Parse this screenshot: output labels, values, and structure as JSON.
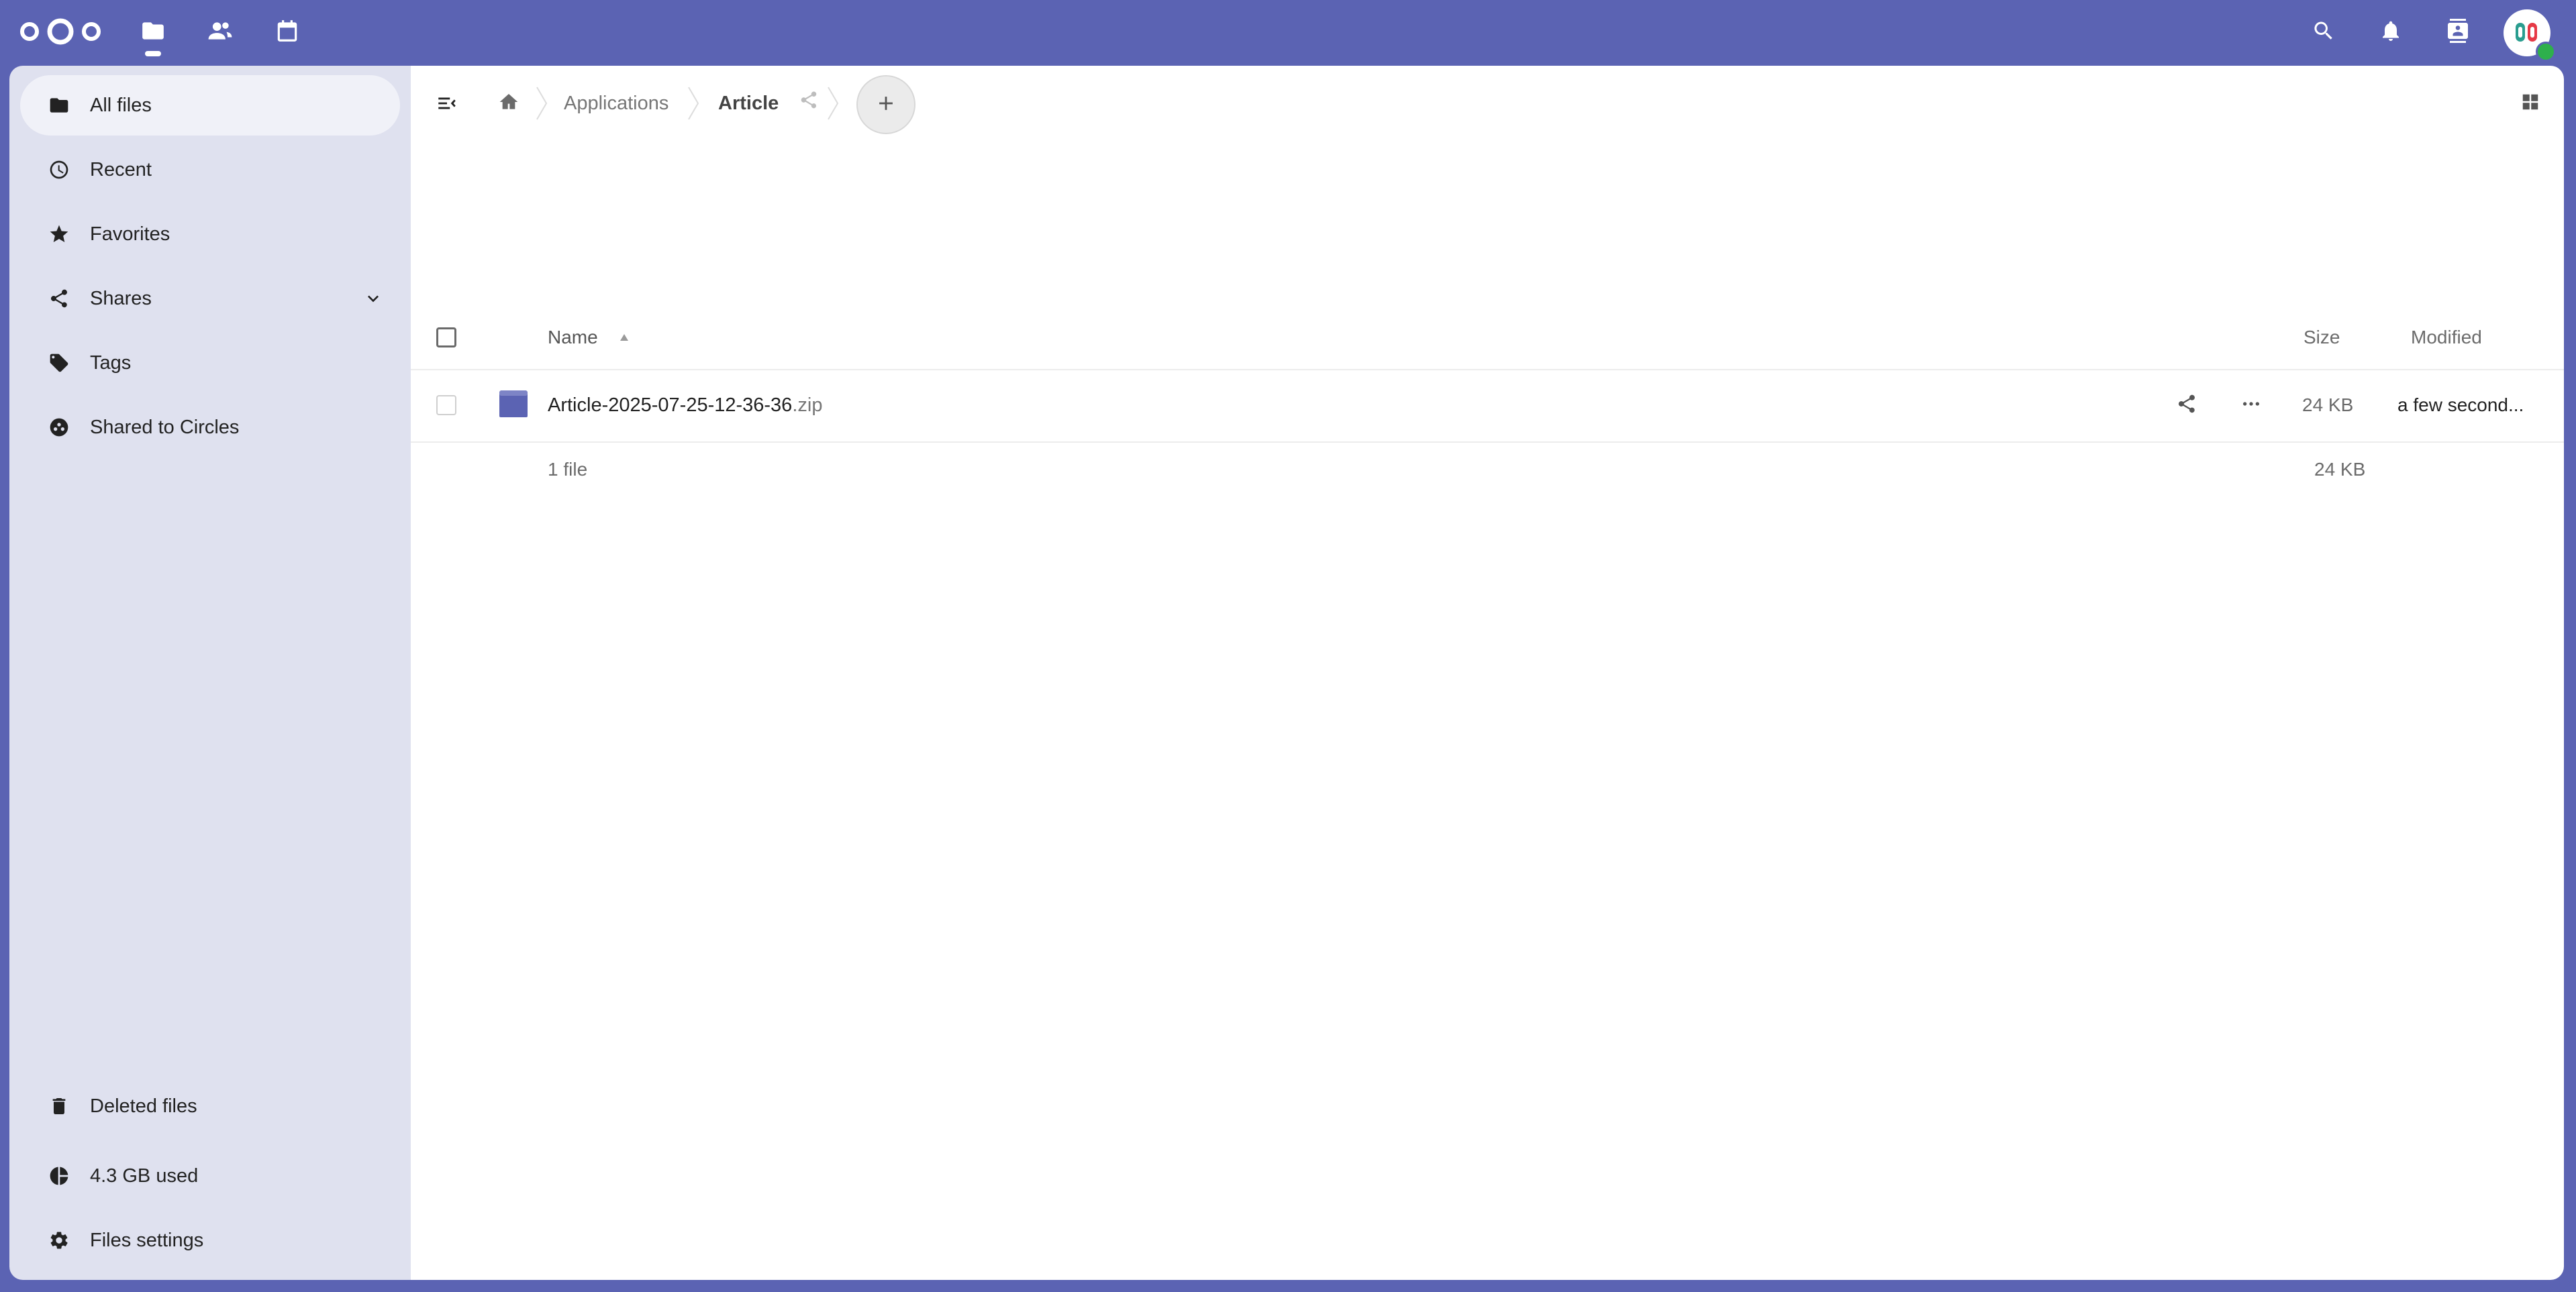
{
  "header": {
    "apps": [
      {
        "name": "Files",
        "icon": "folder-icon"
      },
      {
        "name": "Contacts",
        "icon": "contacts-icon"
      },
      {
        "name": "Calendar",
        "icon": "calendar-icon"
      }
    ],
    "right_icons": [
      "search-icon",
      "bell-icon",
      "contacts-menu-icon"
    ],
    "brand_color": "#5b63b3",
    "status_color": "#2eb04c"
  },
  "sidebar": {
    "items": [
      {
        "label": "All files",
        "icon": "folder-icon",
        "active": true
      },
      {
        "label": "Recent",
        "icon": "clock-icon"
      },
      {
        "label": "Favorites",
        "icon": "star-icon"
      },
      {
        "label": "Shares",
        "icon": "share-icon",
        "expandable": true
      },
      {
        "label": "Tags",
        "icon": "tag-icon"
      },
      {
        "label": "Shared to Circles",
        "icon": "circles-icon"
      }
    ],
    "bottom_items": [
      {
        "label": "Deleted files",
        "icon": "trash-icon"
      },
      {
        "label": "4.3 GB used",
        "icon": "pie-chart-icon"
      },
      {
        "label": "Files settings",
        "icon": "gear-icon"
      }
    ]
  },
  "breadcrumbs": {
    "items": [
      "Applications",
      "Article"
    ],
    "home_icon": "home-icon"
  },
  "table": {
    "columns": {
      "name": "Name",
      "size": "Size",
      "modified": "Modified"
    },
    "sort": {
      "column": "Name",
      "direction": "ascending"
    },
    "rows": [
      {
        "basename": "Article-2025-07-25-12-36-36",
        "extension": ".zip",
        "size": "24 KB",
        "modified": "a few second..."
      }
    ],
    "summary": {
      "count": "1 file",
      "size": "24 KB"
    }
  }
}
